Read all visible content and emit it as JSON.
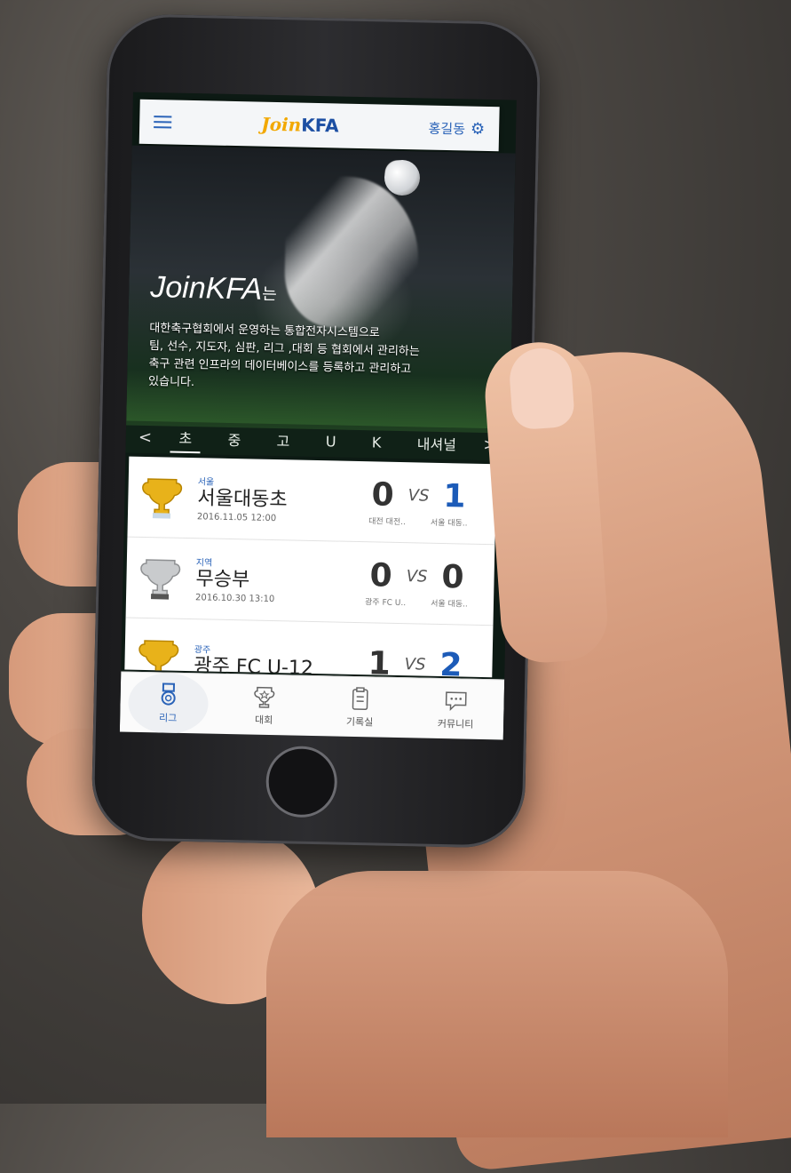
{
  "header": {
    "logo_join": "Join",
    "logo_kfa": "KFA",
    "user_name": "홍길동"
  },
  "hero": {
    "title": "JoinKFA",
    "title_suffix": "는",
    "description_lines": [
      "대한축구협회에서 운영하는 통합전자시스템으로",
      "팀, 선수, 지도자, 심판, 리그 ,대회 등 협회에서 관리하는",
      "축구 관련 인프라의 데이터베이스를 등록하고 관리하고",
      "있습니다."
    ]
  },
  "level_tabs": {
    "prev": "<",
    "next": ">",
    "items": [
      "초",
      "중",
      "고",
      "U",
      "K",
      "내셔널"
    ]
  },
  "matches": [
    {
      "region": "서울",
      "team": "서울대동초",
      "date": "2016.11.05 12:00",
      "score_left": "0",
      "vs": "VS",
      "score_right": "1",
      "team_left": "대전 대전..",
      "team_right": "서울 대동..",
      "trophy": "gold-trophy"
    },
    {
      "region": "지역",
      "team": "무승부",
      "date": "2016.10.30 13:10",
      "score_left": "0",
      "vs": "VS",
      "score_right": "0",
      "team_left": "광주 FC U..",
      "team_right": "서울 대동..",
      "trophy": "silver-trophy"
    },
    {
      "region": "광주",
      "team": "광주 FC U-12",
      "date": "",
      "score_left": "1",
      "vs": "VS",
      "score_right": "2",
      "team_left": "",
      "team_right": "",
      "trophy": "gold-trophy"
    }
  ],
  "bottom_nav": [
    {
      "label": "리그",
      "icon": "medal-icon"
    },
    {
      "label": "대회",
      "icon": "trophy-icon"
    },
    {
      "label": "기록실",
      "icon": "clipboard-icon"
    },
    {
      "label": "커뮤니티",
      "icon": "chat-icon"
    }
  ],
  "colors": {
    "brand_blue": "#1c4fa3",
    "brand_yellow": "#f2a800",
    "win_score": "#1c5bb8"
  }
}
